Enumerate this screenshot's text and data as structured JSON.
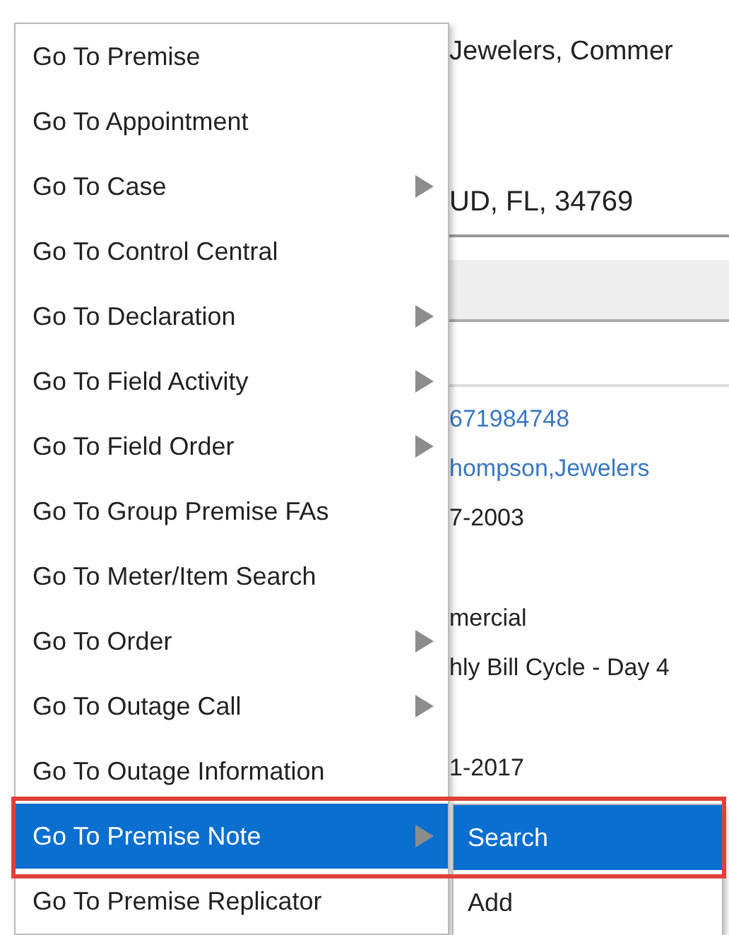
{
  "background": {
    "title": "Jewelers, Commer",
    "address": "UD, FL, 34769",
    "fields": [
      {
        "kind": "link",
        "value": "671984748"
      },
      {
        "kind": "link",
        "value": "hompson,Jewelers"
      },
      {
        "kind": "text",
        "value": "7-2003"
      },
      {
        "kind": "text",
        "value": "mercial"
      },
      {
        "kind": "text",
        "value": "hly Bill Cycle - Day 4"
      },
      {
        "kind": "text",
        "value": "1-2017"
      }
    ]
  },
  "menu": {
    "items": [
      {
        "label": "Go To Premise",
        "has_submenu": false,
        "selected": false
      },
      {
        "label": "Go To Appointment",
        "has_submenu": false,
        "selected": false
      },
      {
        "label": "Go To Case",
        "has_submenu": true,
        "selected": false
      },
      {
        "label": "Go To Control Central",
        "has_submenu": false,
        "selected": false
      },
      {
        "label": "Go To Declaration",
        "has_submenu": true,
        "selected": false
      },
      {
        "label": "Go To Field Activity",
        "has_submenu": true,
        "selected": false
      },
      {
        "label": "Go To Field Order",
        "has_submenu": true,
        "selected": false
      },
      {
        "label": "Go To Group Premise FAs",
        "has_submenu": false,
        "selected": false
      },
      {
        "label": "Go To Meter/Item Search",
        "has_submenu": false,
        "selected": false
      },
      {
        "label": "Go To Order",
        "has_submenu": true,
        "selected": false
      },
      {
        "label": "Go To Outage Call",
        "has_submenu": true,
        "selected": false
      },
      {
        "label": "Go To Outage Information",
        "has_submenu": false,
        "selected": false
      },
      {
        "label": "Go To Premise Note",
        "has_submenu": true,
        "selected": true,
        "annotated": true,
        "submenu": [
          {
            "label": "Search",
            "selected": true
          },
          {
            "label": "Add",
            "selected": false
          }
        ]
      },
      {
        "label": "Go To Premise Replicator",
        "has_submenu": false,
        "selected": false
      }
    ]
  }
}
